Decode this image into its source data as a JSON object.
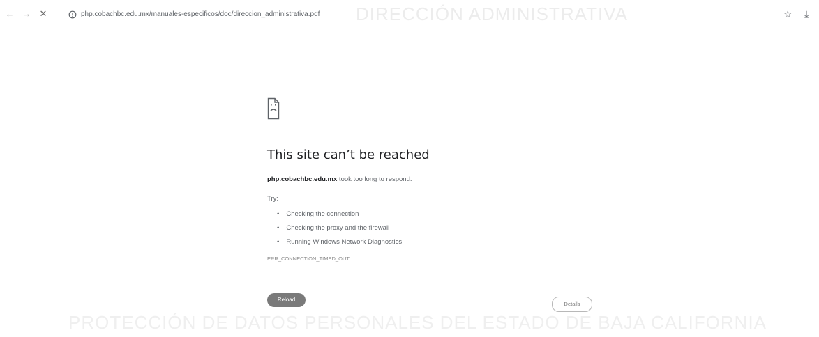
{
  "browser": {
    "url": "php.cobachbc.edu.mx/manuales-especificos/doc/direccion_administrativa.pdf",
    "nav": {
      "back": "←",
      "forward": "→",
      "stop": "✕"
    },
    "background_title": "DIRECCIÓN ADMINISTRATIVA",
    "icons": {
      "star": "☆",
      "download": "⤓"
    }
  },
  "error": {
    "title": "This site can’t be reached",
    "host": "php.cobachbc.edu.mx",
    "message": " took too long to respond.",
    "try_label": "Try:",
    "suggestions": [
      "Checking the connection",
      "Checking the proxy and the firewall",
      "Running Windows Network Diagnostics"
    ],
    "code": "ERR_CONNECTION_TIMED_OUT",
    "reload_label": "Reload",
    "details_label": "Details"
  },
  "background_footer": "PROTECCIÓN DE DATOS PERSONALES DEL ESTADO DE BAJA CALIFORNIA"
}
